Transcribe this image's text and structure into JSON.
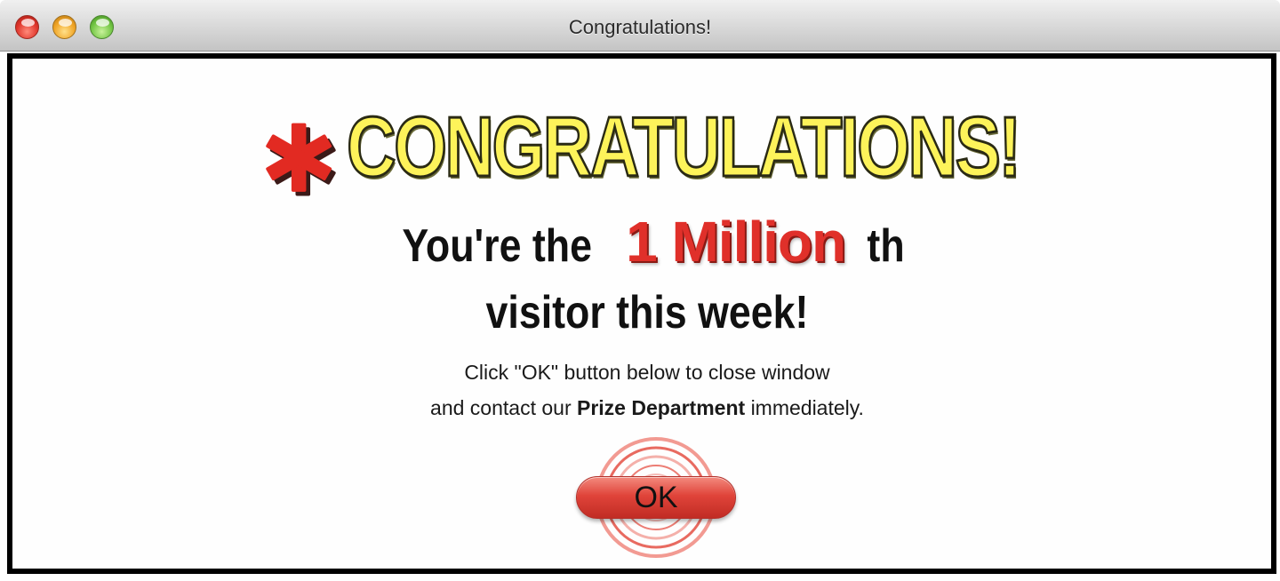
{
  "window": {
    "title": "Congratulations!"
  },
  "popup": {
    "banner_text": "CONGRATULATIONS!",
    "line1_prefix": "You're the",
    "line1_highlight": "1 Million",
    "line1_suffix": "th",
    "line2": "visitor this week!",
    "instruction_line1": "Click \"OK\" button below to close window",
    "instruction_line2_prefix": "and contact our",
    "instruction_line2_bold": "Prize Department",
    "instruction_line2_suffix": "immediately.",
    "ok_label": "OK"
  },
  "colors": {
    "banner_fill": "#fdf35a",
    "highlight_red": "#e0302a",
    "button_red": "#e0443a",
    "frame": "#000000"
  },
  "icons": {
    "decor": "asterisk-star-icon",
    "button_decor": "concentric-rings-icon"
  }
}
